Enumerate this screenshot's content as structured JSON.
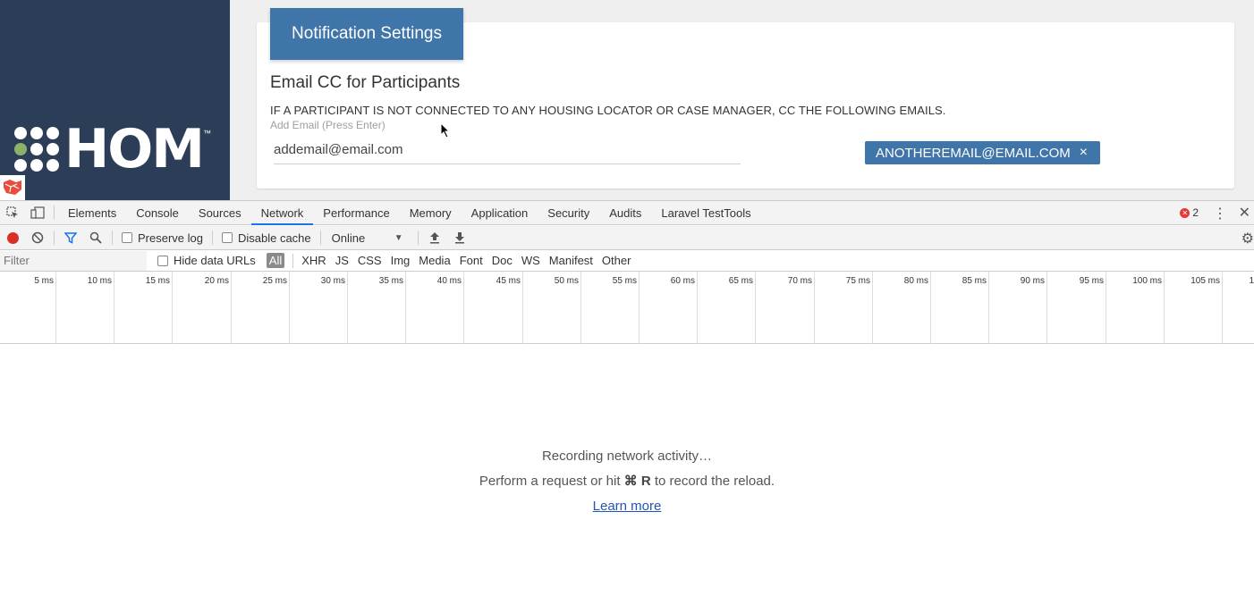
{
  "app": {
    "logo_text": "HOM",
    "logo_tm": "™",
    "card_tab_title": "Notification Settings",
    "section_title": "Email CC for Participants",
    "section_description": "IF A PARTICIPANT IS NOT CONNECTED TO ANY HOUSING LOCATOR OR CASE MANAGER, CC THE FOLLOWING EMAILS.",
    "email_label": "Add Email (Press Enter)",
    "email_value": "addemail@email.com",
    "email_chips": [
      "ANOTHEREMAIL@EMAIL.COM"
    ],
    "chip_close": "×"
  },
  "devtools": {
    "tabs": [
      "Elements",
      "Console",
      "Sources",
      "Network",
      "Performance",
      "Memory",
      "Application",
      "Security",
      "Audits",
      "Laravel TestTools"
    ],
    "active_tab": "Network",
    "error_count": "2",
    "toolbar": {
      "preserve_log": "Preserve log",
      "disable_cache": "Disable cache",
      "throttling": "Online"
    },
    "filter_placeholder": "Filter",
    "hide_data_urls": "Hide data URLs",
    "filter_types": [
      "All",
      "XHR",
      "JS",
      "CSS",
      "Img",
      "Media",
      "Font",
      "Doc",
      "WS",
      "Manifest",
      "Other"
    ],
    "timeline_ticks": [
      "5 ms",
      "10 ms",
      "15 ms",
      "20 ms",
      "25 ms",
      "30 ms",
      "35 ms",
      "40 ms",
      "45 ms",
      "50 ms",
      "55 ms",
      "60 ms",
      "65 ms",
      "70 ms",
      "75 ms",
      "80 ms",
      "85 ms",
      "90 ms",
      "95 ms",
      "100 ms",
      "105 ms",
      "1"
    ],
    "empty_state": {
      "recording": "Recording network activity…",
      "hint_prefix": "Perform a request or hit ",
      "hint_shortcut": "⌘ R",
      "hint_suffix": " to record the reload.",
      "learn_more": "Learn more"
    }
  },
  "colors": {
    "sidebar": "#2c3e57",
    "accent_blue": "#3f75a8",
    "record_red": "#d93025",
    "link_blue": "#1f56b8"
  }
}
